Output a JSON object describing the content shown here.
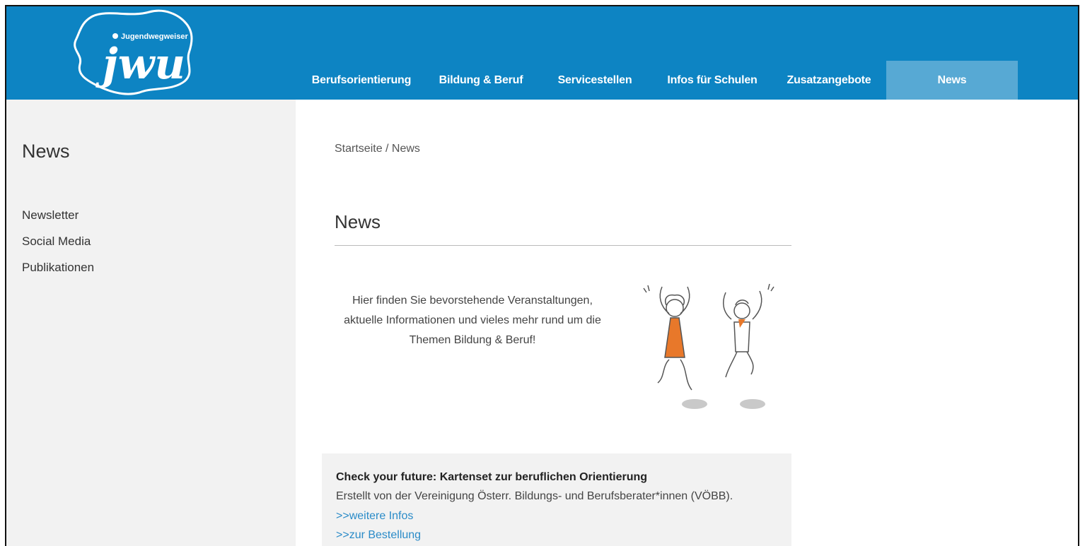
{
  "logo": {
    "brand_text": "Jugendwegweiser",
    "mark": "jwu"
  },
  "nav": {
    "items": [
      {
        "label": "Berufsorientierung"
      },
      {
        "label": "Bildung & Beruf"
      },
      {
        "label": "Servicestellen"
      },
      {
        "label": "Infos für Schulen"
      },
      {
        "label": "Zusatzangebote"
      },
      {
        "label": "News",
        "active": true
      }
    ]
  },
  "sidebar": {
    "title": "News",
    "items": [
      {
        "label": "Newsletter"
      },
      {
        "label": "Social Media"
      },
      {
        "label": "Publikationen"
      }
    ]
  },
  "breadcrumb": "Startseite / News",
  "page_title": "News",
  "intro": "Hier finden Sie bevorstehende Veranstaltungen, aktuelle Informationen und vieles mehr rund um die Themen Bildung & Beruf!",
  "news": [
    {
      "title": "Check your future: Kartenset zur beruflichen Orientierung",
      "description": "Erstellt von der Vereinigung Österr. Bildungs- und Berufsberater*innen (VÖBB).",
      "links": [
        ">>weitere Infos",
        ">>zur Bestellung"
      ]
    }
  ],
  "colors": {
    "header": "#0d84c3",
    "nav_active": "#57a9d4",
    "sidebar_bg": "#f2f2f2",
    "link": "#2a8bc8",
    "accent_orange": "#e8782a"
  }
}
